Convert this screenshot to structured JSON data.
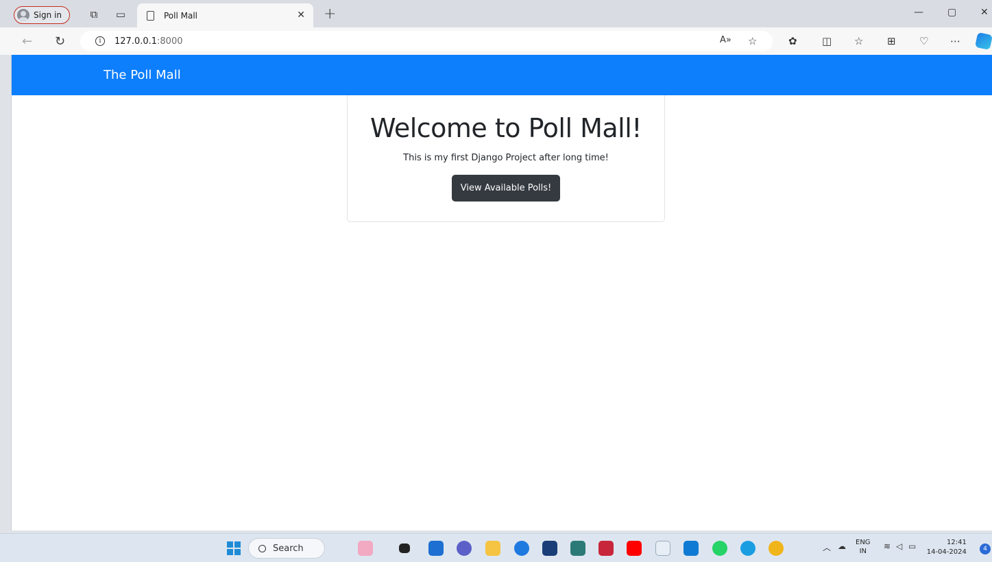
{
  "browser": {
    "profile_label": "Sign in",
    "tab_title": "Poll Mall",
    "url_host": "127.0.0.1",
    "url_port": ":8000"
  },
  "page": {
    "brand": "The Poll Mall",
    "heading": "Welcome to Poll Mall!",
    "subtext": "This is my first Django Project after long time!",
    "button_label": "View Available Polls!"
  },
  "taskbar": {
    "search_label": "Search",
    "lang_top": "ENG",
    "lang_bottom": "IN",
    "time": "12:41",
    "date": "14-04-2024",
    "notification_count": "4"
  },
  "colors": {
    "navbar": "#0d7efc",
    "button": "#343a40"
  }
}
